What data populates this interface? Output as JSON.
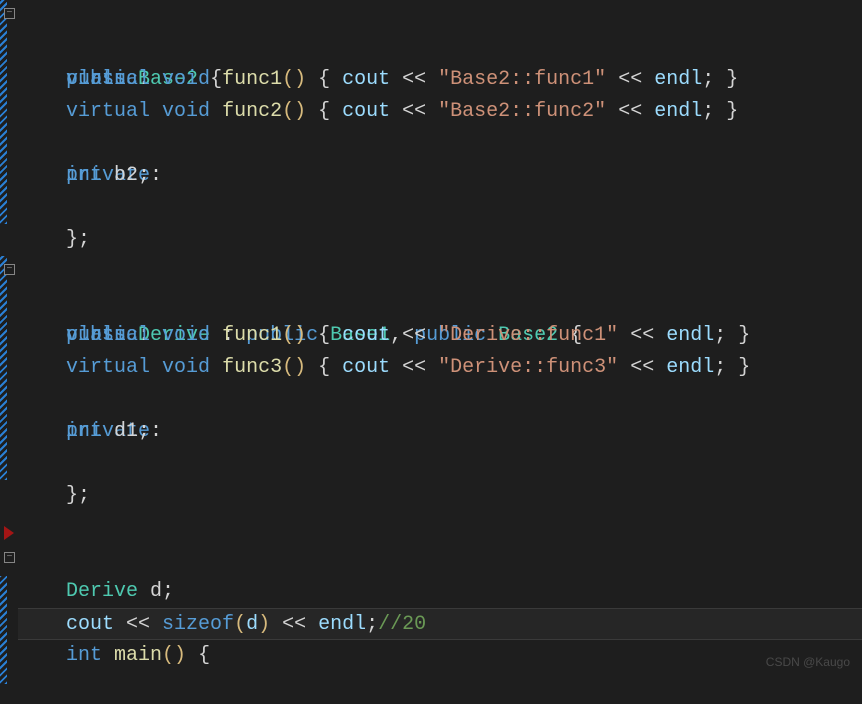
{
  "watermark": "CSDN @Kaugo",
  "code": {
    "l1": {
      "kw_class": "class",
      "name": "Base2",
      "brace": " {"
    },
    "l2": {
      "kw": "public",
      "colon": ":"
    },
    "l3": {
      "kw_virtual": "virtual",
      "kw_void": "void",
      "fn": "func1",
      "parens": "()",
      "body_open": " { ",
      "cout": "cout",
      "op1": " << ",
      "str": "\"Base2::func1\"",
      "op2": " << ",
      "endl": "endl",
      "semi": ";",
      "body_close": " }"
    },
    "l4": {
      "kw_virtual": "virtual",
      "kw_void": "void",
      "fn": "func2",
      "parens": "()",
      "body_open": " { ",
      "cout": "cout",
      "op1": " << ",
      "str": "\"Base2::func2\"",
      "op2": " << ",
      "endl": "endl",
      "semi": ";",
      "body_close": " }"
    },
    "l5": {
      "kw": "private",
      "colon": ":"
    },
    "l6": {
      "kw_int": "int",
      "var": " b2",
      "semi": ";"
    },
    "l7": {
      "close": "};"
    },
    "l9": {
      "kw_class": "class",
      "name": "Derive",
      "colon": " : ",
      "kw_pub1": "public",
      "base1": " Base1",
      "comma": ", ",
      "kw_pub2": "public",
      "base2": " Base2",
      "brace": " {"
    },
    "l10": {
      "kw": "public",
      "colon": ":"
    },
    "l11": {
      "kw_virtual": "virtual",
      "kw_void": "void",
      "fn": "func1",
      "parens": "()",
      "body_open": " { ",
      "cout": "cout",
      "op1": " << ",
      "str": "\"Derive::func1\"",
      "op2": " << ",
      "endl": "endl",
      "semi": ";",
      "body_close": " }"
    },
    "l12": {
      "kw_virtual": "virtual",
      "kw_void": "void",
      "fn": "func3",
      "parens": "()",
      "body_open": " { ",
      "cout": "cout",
      "op1": " << ",
      "str": "\"Derive::func3\"",
      "op2": " << ",
      "endl": "endl",
      "semi": ";",
      "body_close": " }"
    },
    "l13": {
      "kw": "private",
      "colon": ":"
    },
    "l14": {
      "kw_int": "int",
      "var": " d1",
      "semi": ";"
    },
    "l15": {
      "close": "};"
    },
    "l18": {
      "kw_int": "int",
      "fn": " main",
      "parens": "()",
      "brace": " {"
    },
    "l19": {
      "type": "Derive",
      "var": " d",
      "semi": ";"
    },
    "l20": {
      "cout": "cout",
      "op1": " << ",
      "sizeof": "sizeof",
      "lp": "(",
      "arg": "d",
      "rp": ")",
      "op2": " << ",
      "endl": "endl",
      "semi": ";",
      "comment": "//20"
    }
  }
}
